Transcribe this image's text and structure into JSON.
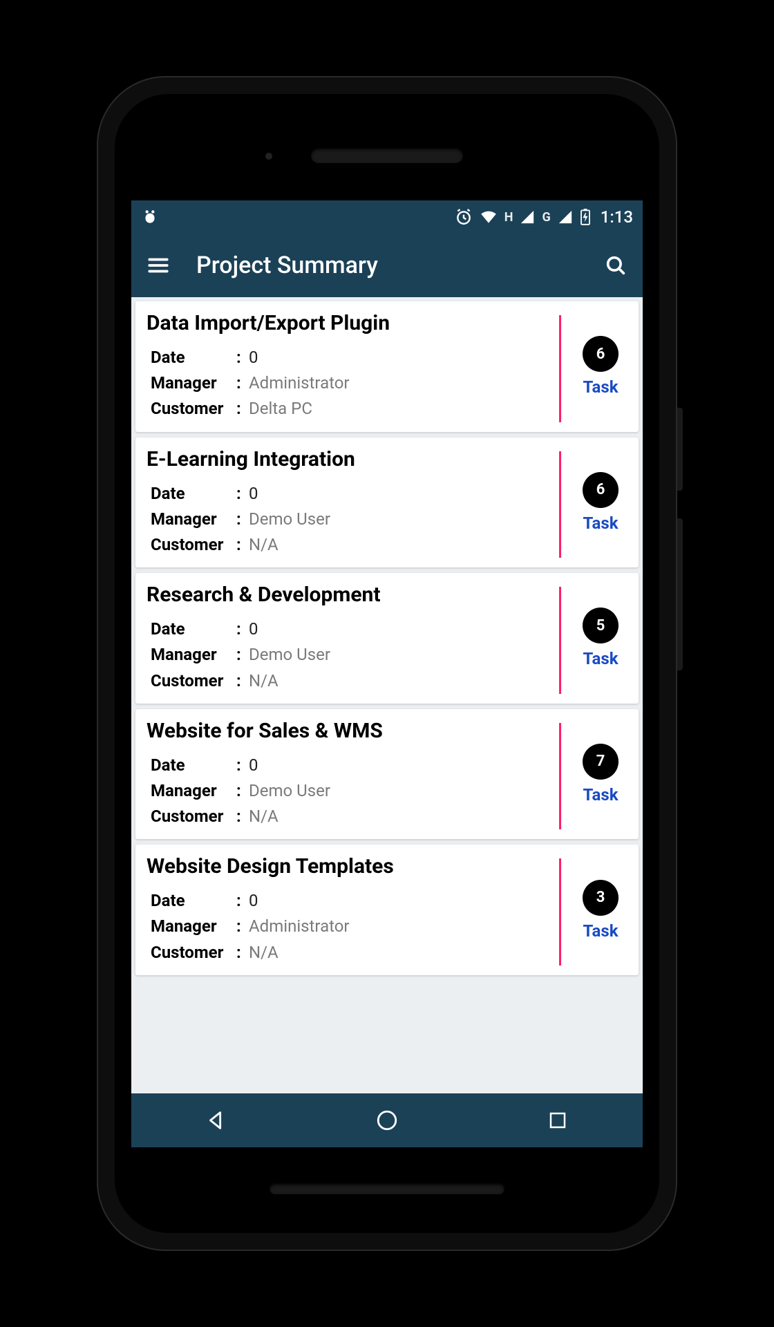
{
  "status": {
    "time": "1:13",
    "network1_label": "H",
    "network2_label": "G"
  },
  "appbar": {
    "title": "Project Summary"
  },
  "labels": {
    "date": "Date",
    "manager": "Manager",
    "customer": "Customer",
    "task": "Task"
  },
  "projects": [
    {
      "title": "Data Import/Export Plugin",
      "date": "0",
      "manager": "Administrator",
      "customer": "Delta PC",
      "tasks": "6"
    },
    {
      "title": "E-Learning Integration",
      "date": "0",
      "manager": "Demo User",
      "customer": "N/A",
      "tasks": "6"
    },
    {
      "title": "Research & Development",
      "date": "0",
      "manager": "Demo User",
      "customer": "N/A",
      "tasks": "5"
    },
    {
      "title": "Website for Sales & WMS",
      "date": "0",
      "manager": "Demo User",
      "customer": "N/A",
      "tasks": "7"
    },
    {
      "title": "Website Design Templates",
      "date": "0",
      "manager": "Administrator",
      "customer": "N/A",
      "tasks": "3"
    }
  ]
}
